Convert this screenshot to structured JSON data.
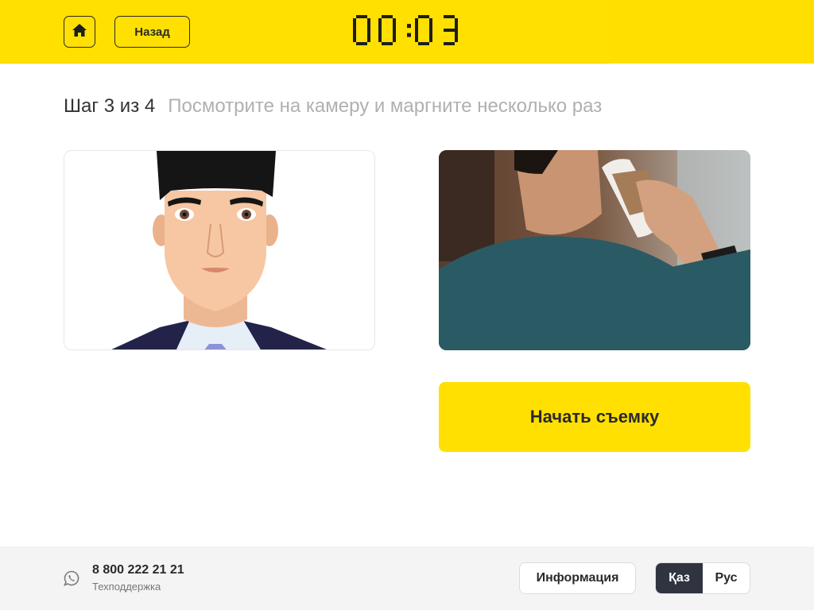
{
  "header": {
    "home_icon": "home-icon",
    "back_label": "Назад",
    "timer": "00:03",
    "accent_color": "#ffe000"
  },
  "step": {
    "counter": "Шаг 3 из 4",
    "hint": "Посмотрите на камеру и маргните несколько раз"
  },
  "main": {
    "start_button_label": "Начать съемку"
  },
  "footer": {
    "phone_icon": "whatsapp-icon",
    "phone_number": "8 800 222 21 21",
    "support_label": "Техподдержка",
    "info_button_label": "Информация",
    "languages": [
      {
        "label": "Қаз",
        "active": true
      },
      {
        "label": "Рус",
        "active": false
      }
    ]
  }
}
